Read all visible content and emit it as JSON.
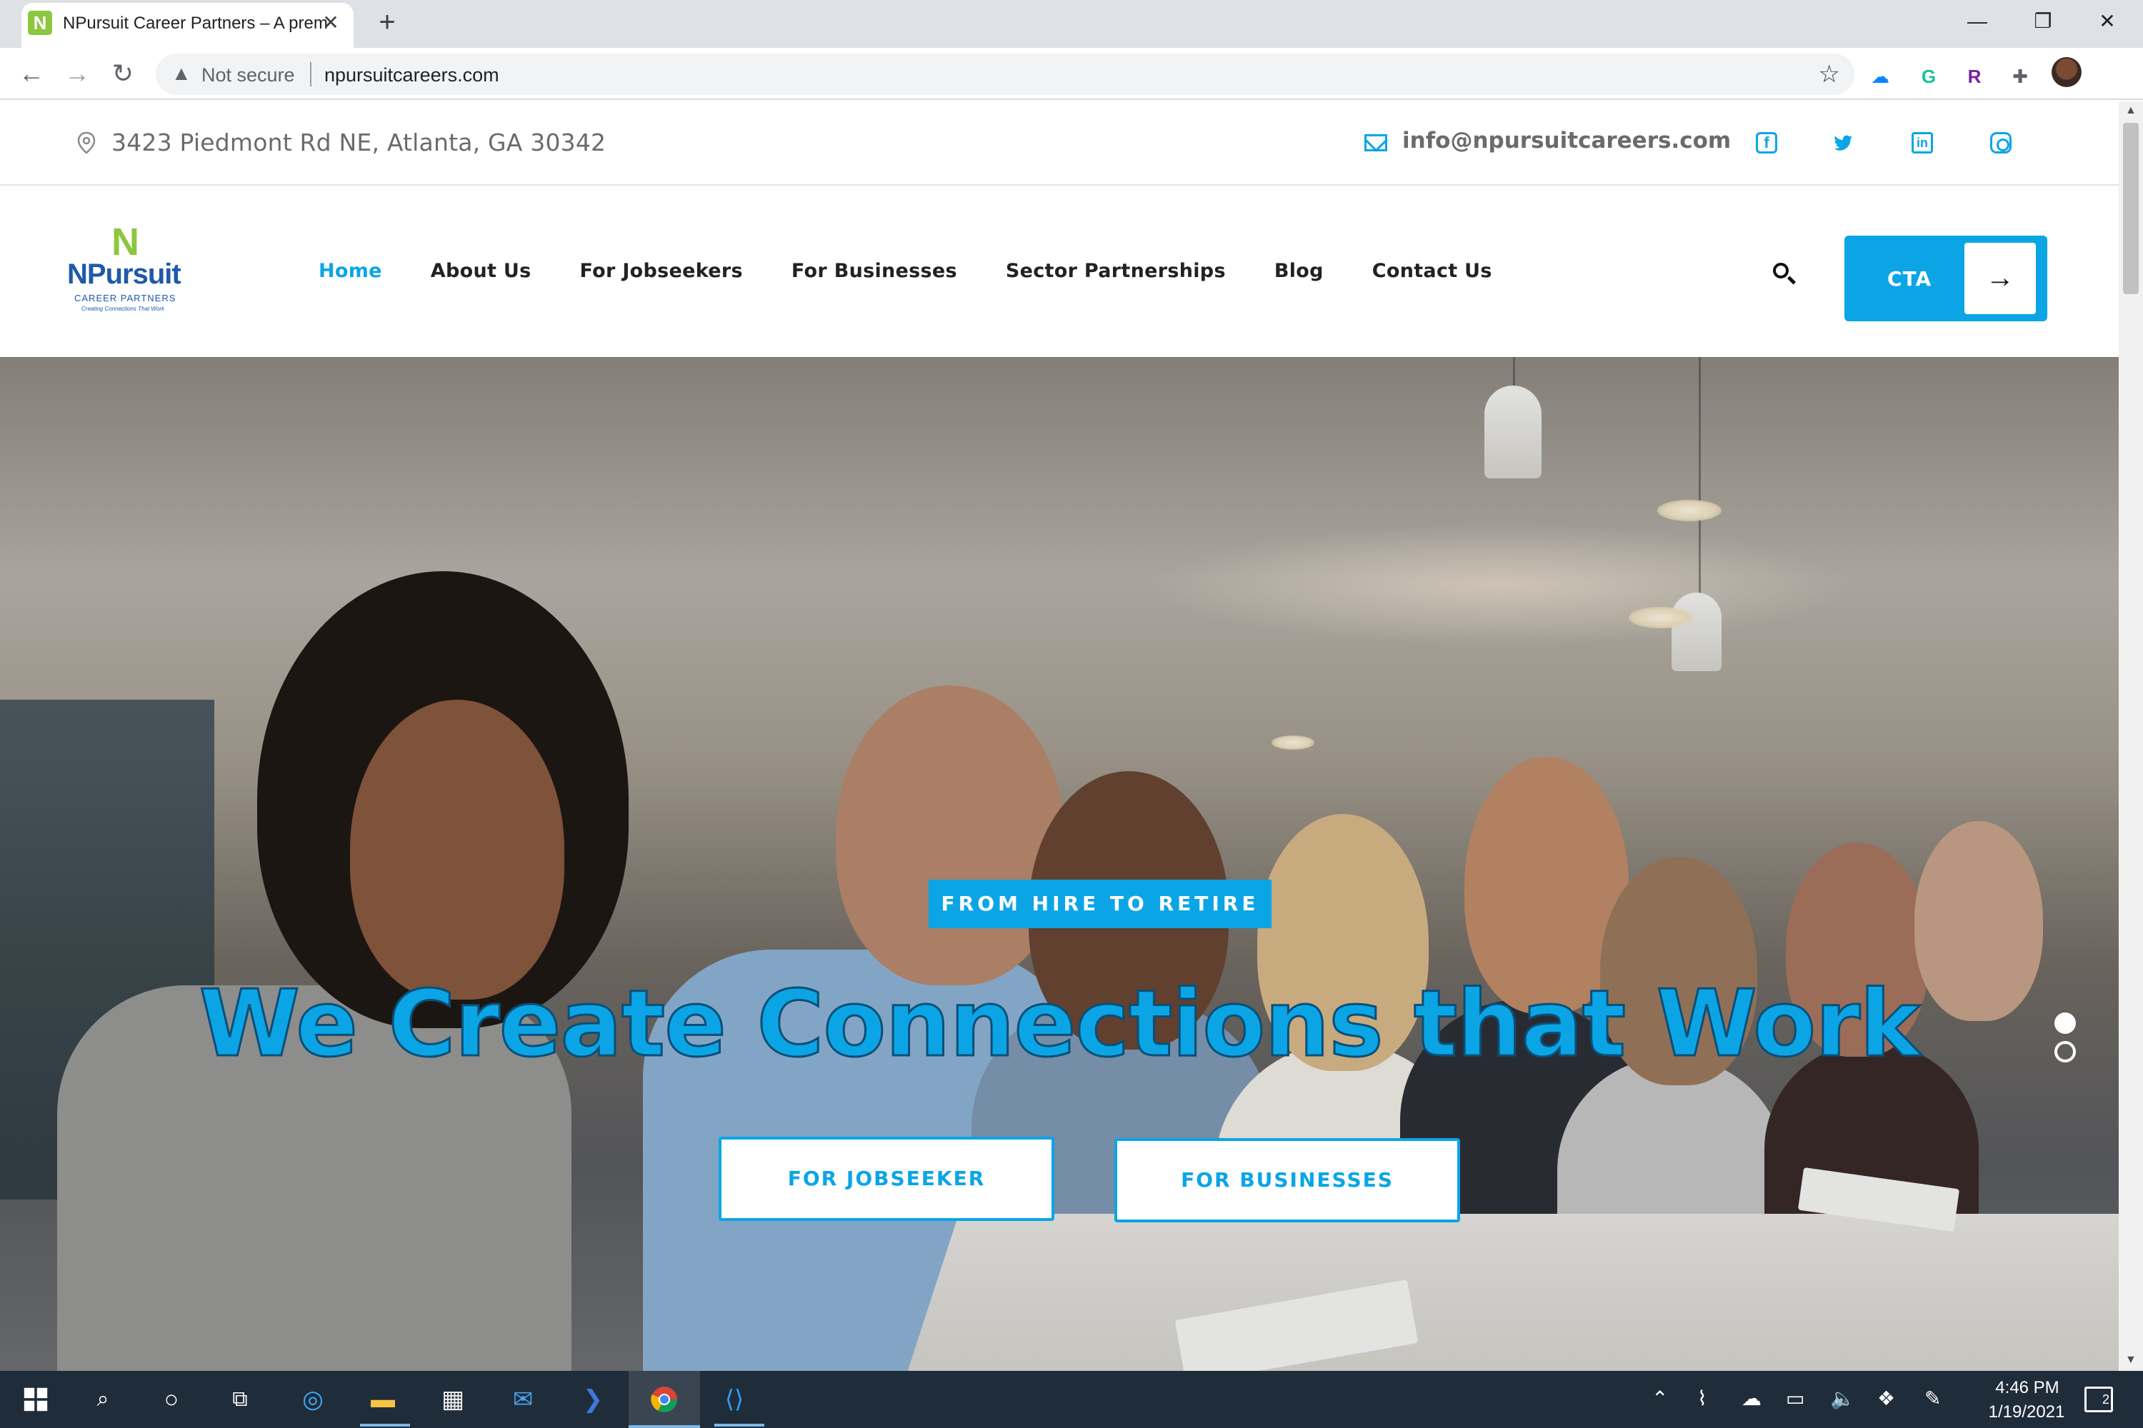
{
  "browser": {
    "tab_title": "NPursuit Career Partners – A premier",
    "tab_favicon_letter": "N",
    "close_tab_symbol": "✕",
    "new_tab_symbol": "+",
    "security_label": "Not secure",
    "url": "npursuitcareers.com",
    "window_controls": {
      "minimize": "—",
      "restore": "❐",
      "close": "✕"
    },
    "nav_symbols": {
      "back": "←",
      "forward": "→",
      "reload": "↻",
      "star": "☆",
      "menu": "⋮"
    },
    "extensions": [
      {
        "name": "onedrive-icon",
        "glyph": "☁",
        "color": "#0a84ff"
      },
      {
        "name": "grammarly-icon",
        "glyph": "G",
        "color": "#15c39a"
      },
      {
        "name": "r-extension-icon",
        "glyph": "R",
        "color": "#7b1fa2"
      },
      {
        "name": "puzzle-icon",
        "glyph": "✚",
        "color": "#5f6368"
      }
    ]
  },
  "topbar": {
    "address": "3423 Piedmont Rd NE, Atlanta, GA 30342",
    "email": "info@npursuitcareers.com",
    "socials": [
      {
        "name": "facebook-icon",
        "glyph": "f"
      },
      {
        "name": "twitter-icon",
        "glyph": "🐦"
      },
      {
        "name": "linkedin-icon",
        "glyph": "in"
      },
      {
        "name": "instagram-icon",
        "glyph": ""
      }
    ]
  },
  "logo": {
    "mark": "N",
    "name": "NPursuit",
    "sub": "CAREER PARTNERS",
    "tagline": "Creating Connections That Work"
  },
  "nav": {
    "items": [
      {
        "label": "Home",
        "active": true
      },
      {
        "label": "About Us",
        "active": false
      },
      {
        "label": "For Jobseekers",
        "active": false
      },
      {
        "label": "For Businesses",
        "active": false
      },
      {
        "label": "Sector Partnerships",
        "active": false
      },
      {
        "label": "Blog",
        "active": false
      },
      {
        "label": "Contact Us",
        "active": false
      }
    ],
    "cta_label": "CTA",
    "cta_arrow": "→"
  },
  "hero": {
    "badge": "FROM HIRE TO RETIRE",
    "headline": "We Create Connections that Work",
    "button_jobseeker": "FOR JOBSEEKER",
    "button_businesses": "FOR BUSINESSES",
    "slide_count": 2,
    "active_slide": 1
  },
  "taskbar": {
    "time": "4:46 PM",
    "date": "1/19/2021",
    "notification_count": "2"
  },
  "colors": {
    "accent": "#0ba5e6",
    "logo_green": "#8dc63f",
    "logo_blue": "#1e5aa8",
    "taskbar": "#1f2c3a"
  }
}
